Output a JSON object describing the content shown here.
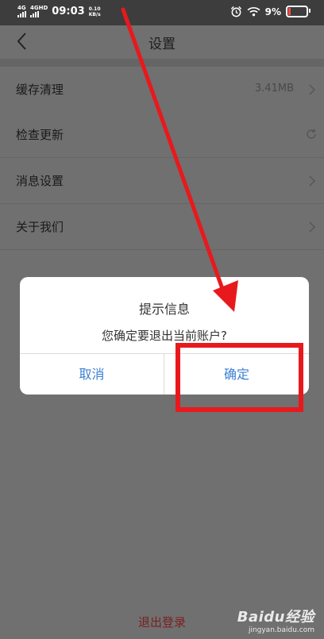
{
  "status_bar": {
    "net1": "4G",
    "net2": "4GHD",
    "time": "09:03",
    "speed_value": "0.10",
    "speed_unit": "KB/s",
    "battery": "9%"
  },
  "header": {
    "title": "设置"
  },
  "settings": {
    "cache_label": "缓存清理",
    "cache_value": "3.41MB",
    "update_label": "检查更新",
    "notify_label": "消息设置",
    "about_label": "关于我们"
  },
  "logout_label": "退出登录",
  "dialog": {
    "title": "提示信息",
    "message": "您确定要退出当前账户?",
    "cancel_label": "取消",
    "confirm_label": "确定"
  },
  "watermark": {
    "logo_text": "Baidu经验",
    "url": "jingyan.baidu.com"
  },
  "colors": {
    "annotation": "#e8191d",
    "dialog_button": "#3b7fd4",
    "logout": "#7a2020"
  }
}
